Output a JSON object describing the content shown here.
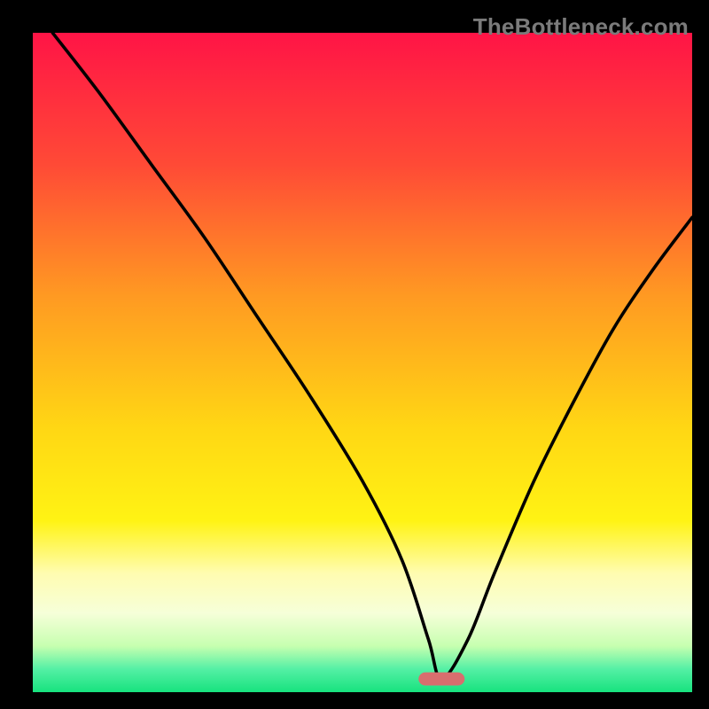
{
  "watermark": "TheBottleneck.com",
  "chart_data": {
    "type": "line",
    "title": "",
    "xlabel": "",
    "ylabel": "",
    "xlim": [
      0,
      100
    ],
    "ylim": [
      0,
      100
    ],
    "grid": false,
    "marker": {
      "x": 62,
      "y": 2,
      "width": 7,
      "height": 2,
      "color": "#d86e6e"
    },
    "series": [
      {
        "name": "curve",
        "x": [
          3,
          10,
          18,
          26,
          34,
          42,
          50,
          56,
          60,
          62,
          66,
          70,
          76,
          82,
          88,
          94,
          100
        ],
        "values": [
          100,
          91,
          80,
          69,
          57,
          45,
          32,
          20,
          8,
          2,
          8,
          18,
          32,
          44,
          55,
          64,
          72
        ]
      }
    ],
    "background_gradient": {
      "stops": [
        {
          "offset": 0.0,
          "color": "#ff1446"
        },
        {
          "offset": 0.2,
          "color": "#ff4a36"
        },
        {
          "offset": 0.4,
          "color": "#ff9a22"
        },
        {
          "offset": 0.6,
          "color": "#ffd714"
        },
        {
          "offset": 0.74,
          "color": "#fff314"
        },
        {
          "offset": 0.82,
          "color": "#fffcb1"
        },
        {
          "offset": 0.88,
          "color": "#f6ffd9"
        },
        {
          "offset": 0.93,
          "color": "#c7ffb0"
        },
        {
          "offset": 0.965,
          "color": "#54f0a5"
        },
        {
          "offset": 1.0,
          "color": "#17e27e"
        }
      ]
    }
  }
}
